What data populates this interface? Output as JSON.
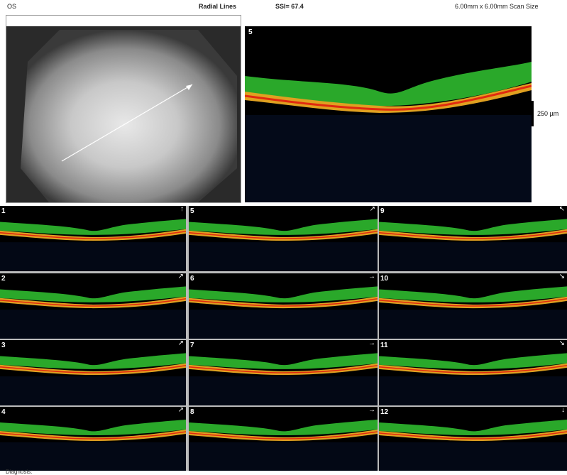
{
  "header": {
    "eye": "OS",
    "scan_type": "Radial Lines",
    "ssi": "SSI= 67.4",
    "scan_size": "6.00mm x 6.00mm Scan Size"
  },
  "main_scan": {
    "number": "5"
  },
  "scale_label": "250 µm",
  "tiles": [
    {
      "number": "1",
      "arrow": "↑"
    },
    {
      "number": "2",
      "arrow": "↗"
    },
    {
      "number": "3",
      "arrow": "↗"
    },
    {
      "number": "4",
      "arrow": "↗"
    },
    {
      "number": "5",
      "arrow": "↗"
    },
    {
      "number": "6",
      "arrow": "→"
    },
    {
      "number": "7",
      "arrow": "→"
    },
    {
      "number": "8",
      "arrow": "→"
    },
    {
      "number": "9",
      "arrow": "↖"
    },
    {
      "number": "10",
      "arrow": "↘"
    },
    {
      "number": "11",
      "arrow": "↘"
    },
    {
      "number": "12",
      "arrow": "↓"
    }
  ],
  "footer": {
    "diagnosis_label": "Diagnosis:"
  }
}
